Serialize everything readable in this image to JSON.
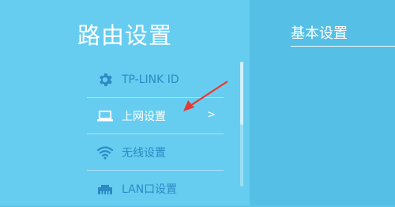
{
  "sidebar": {
    "title": "路由设置",
    "items": [
      {
        "label": "TP-LINK ID",
        "icon": "gear-icon",
        "active": false
      },
      {
        "label": "上网设置",
        "icon": "laptop-icon",
        "active": true,
        "chevron": ">"
      },
      {
        "label": "无线设置",
        "icon": "wifi-icon",
        "active": false
      },
      {
        "label": "LAN口设置",
        "icon": "lan-port-icon",
        "active": false
      }
    ]
  },
  "main": {
    "title": "基本设置"
  },
  "colors": {
    "sidebar_bg": "#66cdf0",
    "main_bg": "#56bfe5",
    "inactive_text": "#2c8ac4",
    "active_text": "#ffffff",
    "annotation_arrow": "#e53935"
  }
}
